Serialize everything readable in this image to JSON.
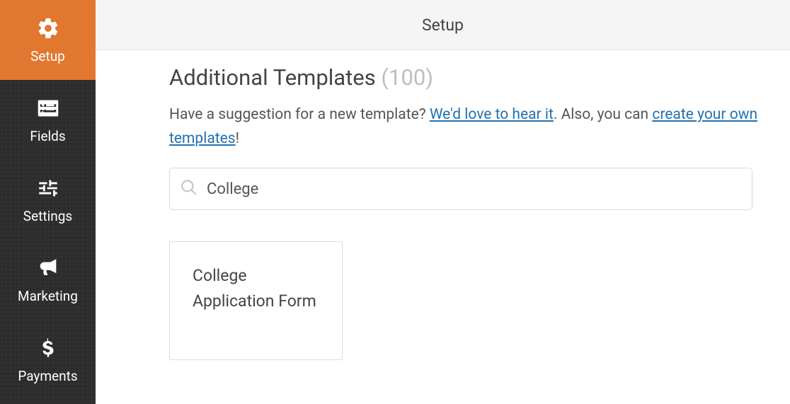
{
  "sidebar": {
    "items": [
      {
        "label": "Setup"
      },
      {
        "label": "Fields"
      },
      {
        "label": "Settings"
      },
      {
        "label": "Marketing"
      },
      {
        "label": "Payments"
      }
    ]
  },
  "header": {
    "title": "Setup"
  },
  "templates": {
    "title": "Additional Templates",
    "count": "(100)",
    "desc_prefix": "Have a suggestion for a new template? ",
    "link1": "We'd love to hear it",
    "desc_mid": ". Also, you can ",
    "link2": "create your own templates",
    "desc_suffix": "!",
    "search_value": "College",
    "results": [
      {
        "title": "College Application Form"
      }
    ]
  }
}
